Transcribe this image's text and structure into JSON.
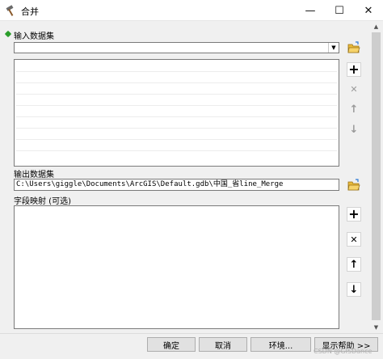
{
  "window": {
    "title": "合并",
    "title_icon": "hammer-icon",
    "minimize_glyph": "—",
    "maximize_glyph": "☐",
    "close_glyph": "✕"
  },
  "inputs": {
    "label": "输入数据集",
    "combo_value": "",
    "list_items": []
  },
  "output": {
    "label": "输出数据集",
    "value": "C:\\Users\\giggle\\Documents\\ArcGIS\\Default.gdb\\中国_省line_Merge"
  },
  "field_map": {
    "label": "字段映射 (可选)"
  },
  "toolbar_icons": {
    "add": "+",
    "remove": "✕",
    "up": "↑",
    "down": "↓"
  },
  "buttons": {
    "ok": "确定",
    "cancel": "取消",
    "environments": "环境...",
    "show_help": "显示帮助 >>"
  },
  "watermark": "CSDN @GISDance",
  "colors": {
    "required_indicator": "#2a9d2a",
    "folder_yellow": "#e8b838"
  }
}
